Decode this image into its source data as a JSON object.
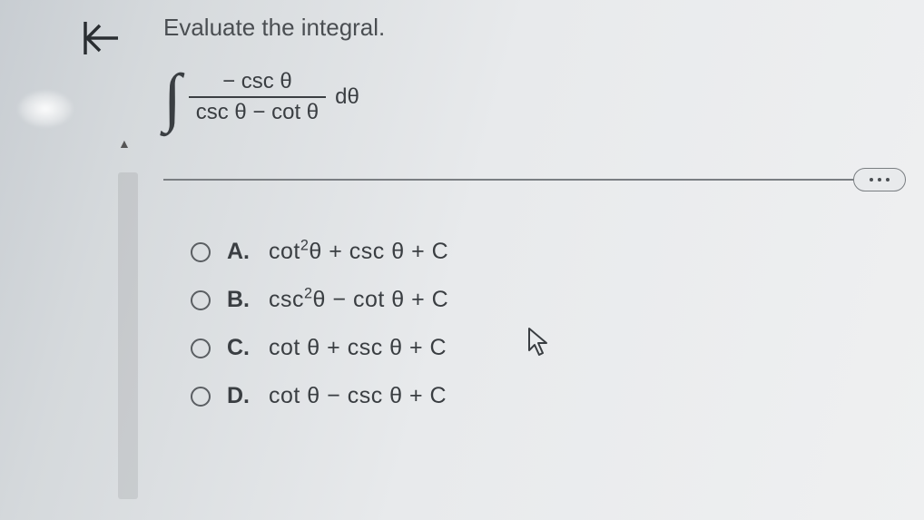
{
  "question": {
    "prompt": "Evaluate the integral.",
    "integral": {
      "numerator": "− csc θ",
      "denominator": "csc θ − cot θ",
      "differential": "dθ"
    }
  },
  "options": {
    "a": {
      "letter": "A.",
      "text_html": "cot<sup>2</sup>θ + csc θ + C"
    },
    "b": {
      "letter": "B.",
      "text_html": "csc<sup>2</sup>θ − cot θ + C"
    },
    "c": {
      "letter": "C.",
      "text_html": "cot θ + csc θ + C"
    },
    "d": {
      "letter": "D.",
      "text_html": "cot θ − csc θ + C"
    }
  }
}
